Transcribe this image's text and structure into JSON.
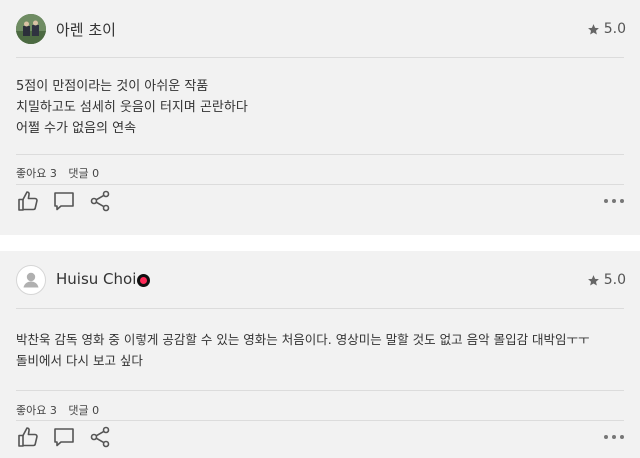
{
  "reviews": [
    {
      "username": "아렌 초이",
      "rating": "5.0",
      "lines": [
        "5점이 만점이라는 것이 아쉬운 작품",
        "치밀하고도 섬세히 웃음이 터지며 곤란하다",
        "어쩔 수가 없음의 연속"
      ],
      "likes_label": "좋아요 3",
      "comments_label": "댓글 0",
      "avatar": "profile-photo",
      "badge": false
    },
    {
      "username": "Huisu Choi",
      "rating": "5.0",
      "lines": [
        "박찬욱 감독 영화 중 이렇게 공감할 수 있는 영화는 처음이다. 영상미는 말할 것도 없고 음악 몰입감 대박임ㅜㅜ",
        "돌비에서 다시 보고 싶다"
      ],
      "likes_label": "좋아요 3",
      "comments_label": "댓글 0",
      "avatar": "default-user-icon",
      "badge": true
    }
  ],
  "icons": {
    "rating": "star-icon",
    "like": "thumbs-up-icon",
    "comment": "comment-icon",
    "share": "share-icon",
    "more": "more-options-icon"
  },
  "colors": {
    "card_background": "#f2f2f2",
    "badge_accent": "#ff2a58"
  }
}
